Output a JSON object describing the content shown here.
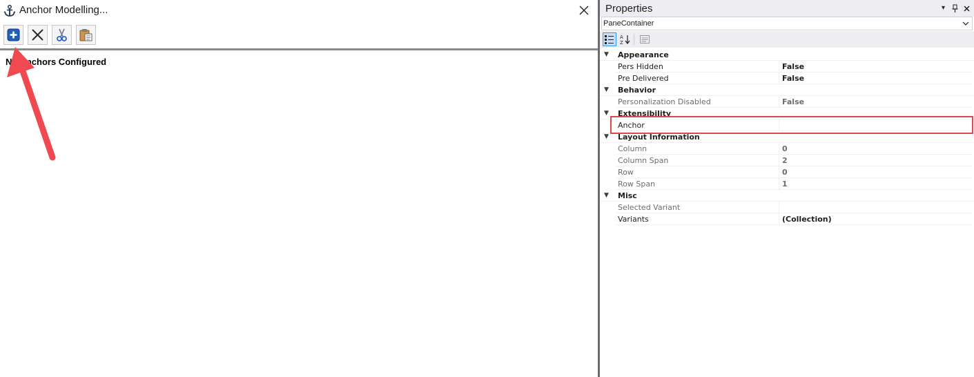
{
  "dialog": {
    "title": "Anchor Modelling...",
    "toolbar": {
      "add_icon": "add-anchor-icon",
      "delete_icon": "delete-x-icon",
      "cut_icon": "scissors-icon",
      "paste_icon": "clipboard-paste-icon"
    },
    "status": "No Anchors Configured"
  },
  "properties": {
    "title": "Properties",
    "object": "PaneContainer",
    "categories": [
      {
        "label": "Appearance",
        "props": [
          {
            "name": "Pers Hidden",
            "value": "False",
            "enabled": true
          },
          {
            "name": "Pre Delivered",
            "value": "False",
            "enabled": true
          }
        ]
      },
      {
        "label": "Behavior",
        "props": [
          {
            "name": "Personalization Disabled",
            "value": "False",
            "enabled": false
          }
        ]
      },
      {
        "label": "Extensibility",
        "props": [
          {
            "name": "Anchor",
            "value": "",
            "enabled": true
          }
        ]
      },
      {
        "label": "Layout Information",
        "props": [
          {
            "name": "Column",
            "value": "0",
            "enabled": false
          },
          {
            "name": "Column Span",
            "value": "2",
            "enabled": false
          },
          {
            "name": "Row",
            "value": "0",
            "enabled": false
          },
          {
            "name": "Row Span",
            "value": "1",
            "enabled": false
          }
        ]
      },
      {
        "label": "Misc",
        "props": [
          {
            "name": "Selected Variant",
            "value": "",
            "enabled": false
          },
          {
            "name": "Variants",
            "value": "(Collection)",
            "enabled": true
          }
        ]
      }
    ]
  },
  "colors": {
    "highlight": "#e0474c",
    "arrow": "#f0494f",
    "add_button": "#1f5fb8"
  }
}
